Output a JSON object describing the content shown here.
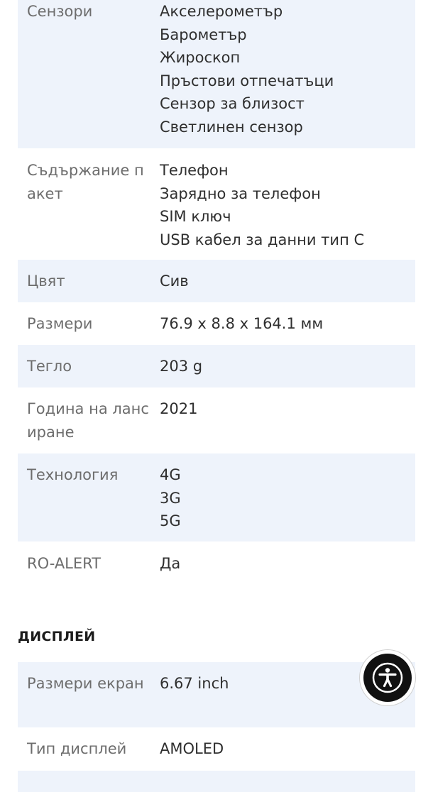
{
  "specs_top": [
    {
      "label": "Сензори",
      "values": [
        "Акселерометър",
        "Барометър",
        "Жироскоп",
        "Пръстови отпечатъци",
        "Сензор за близост",
        "Светлинен сензор"
      ]
    },
    {
      "label": "Съдържание пакет",
      "values": [
        "Телефон",
        "Зарядно за телефон",
        "SIM ключ",
        "USB кабел за данни тип C"
      ]
    },
    {
      "label": "Цвят",
      "values": [
        "Сив"
      ]
    },
    {
      "label": "Размери",
      "values": [
        "76.9 x 8.8 x 164.1 мм"
      ]
    },
    {
      "label": "Тегло",
      "values": [
        "203 g"
      ]
    },
    {
      "label": "Година на лансиране",
      "values": [
        "2021"
      ]
    },
    {
      "label": "Технология",
      "values": [
        "4G",
        "3G",
        "5G"
      ]
    },
    {
      "label": "RO-ALERT",
      "values": [
        "Да"
      ]
    }
  ],
  "section": {
    "title": "ДИСПЛЕЙ"
  },
  "specs_display": [
    {
      "label": "Размери екран",
      "values": [
        "6.67 inch"
      ]
    },
    {
      "label": "Тип дисплей",
      "values": [
        "AMOLED"
      ]
    }
  ],
  "accessibility_button": {
    "icon": "accessibility-icon",
    "color": "#111111"
  },
  "colors": {
    "stripe": "#eef3fb",
    "label": "#6d6d6d",
    "value": "#2f2f2f"
  }
}
